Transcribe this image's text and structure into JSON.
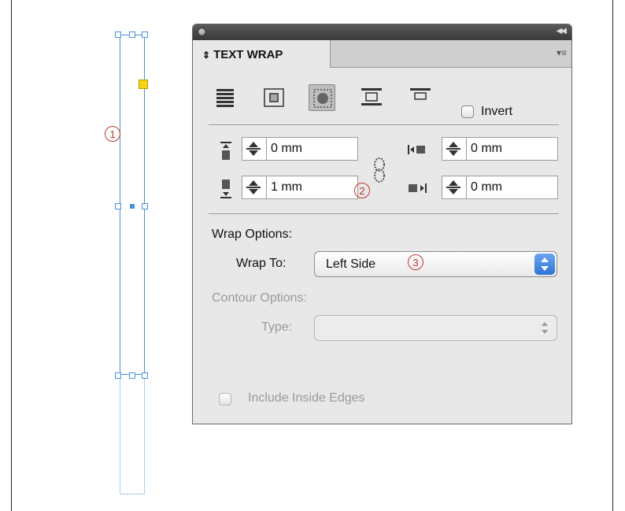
{
  "panel": {
    "tab_label": "TEXT WRAP",
    "invert_label": "Invert",
    "offsets": {
      "top": "0 mm",
      "bottom": "1 mm",
      "left": "0 mm",
      "right": "0 mm"
    },
    "wrap_options_heading": "Wrap Options:",
    "wrap_to_label": "Wrap To:",
    "wrap_to_value": "Left Side",
    "contour_heading": "Contour Options:",
    "type_label": "Type:",
    "type_value": "",
    "include_inside_edges_label": "Include Inside Edges"
  },
  "callouts": [
    "1",
    "2",
    "3"
  ],
  "colors": {
    "frame_blue": "#4a90e2",
    "callout_red": "#c0392b",
    "port_yellow": "#f5d416",
    "stepper_blue": "#2f74d6"
  }
}
